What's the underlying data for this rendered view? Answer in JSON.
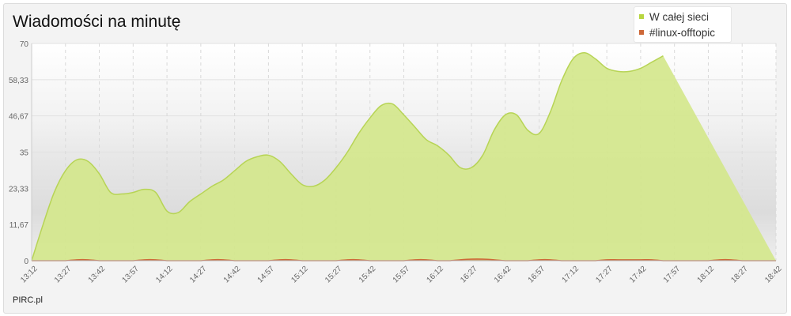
{
  "colors": {
    "series_fill": "#d4e78c",
    "series_line": "#b7d455",
    "series2": "#cd6838",
    "legend_marker1": "#b8d640",
    "legend_marker2": "#cd6838"
  },
  "chart_data": {
    "type": "area",
    "title": "Wiadomości na minutę",
    "credit": "PIRC.pl",
    "ylim": [
      0,
      70
    ],
    "y_ticks": [
      "0",
      "11,67",
      "23,33",
      "35",
      "46,67",
      "58,33",
      "70"
    ],
    "y_tick_values": [
      0,
      11.67,
      23.33,
      35,
      46.67,
      58.33,
      70
    ],
    "x_tick_labels": [
      "13:12",
      "13:27",
      "13:42",
      "13:57",
      "14:12",
      "14:27",
      "14:42",
      "14:57",
      "15:12",
      "15:27",
      "15:42",
      "15:57",
      "16:12",
      "16:27",
      "16:42",
      "16:57",
      "17:12",
      "17:27",
      "17:42",
      "17:57",
      "18:12",
      "18:27",
      "18:42"
    ],
    "legend_position": "top-right",
    "grid": true,
    "x": [
      "13:12",
      "13:17",
      "13:22",
      "13:27",
      "13:32",
      "13:37",
      "13:42",
      "13:47",
      "13:52",
      "13:57",
      "14:02",
      "14:07",
      "14:12",
      "14:17",
      "14:22",
      "14:27",
      "14:32",
      "14:37",
      "14:42",
      "14:47",
      "14:52",
      "14:57",
      "15:02",
      "15:07",
      "15:12",
      "15:17",
      "15:22",
      "15:27",
      "15:32",
      "15:37",
      "15:42",
      "15:47",
      "15:52",
      "15:57",
      "16:02",
      "16:07",
      "16:12",
      "16:17",
      "16:22",
      "16:27",
      "16:32",
      "16:37",
      "16:42",
      "16:47",
      "16:52",
      "16:57",
      "17:02",
      "17:07",
      "17:12",
      "17:17",
      "17:22",
      "17:27",
      "17:32",
      "17:37",
      "17:42",
      "17:47",
      "17:52",
      "17:57",
      "18:02",
      "18:07",
      "18:12",
      "18:17",
      "18:22",
      "18:27",
      "18:32",
      "18:37",
      "18:42"
    ],
    "series": [
      {
        "name": "W całej sieci",
        "values": [
          0,
          11.5,
          22,
          29,
          32.5,
          32,
          28,
          22,
          21.5,
          22,
          23,
          22,
          16,
          15.5,
          19,
          21.5,
          24,
          26,
          29,
          32,
          33.5,
          34,
          32,
          28,
          24.5,
          24,
          26,
          30,
          35,
          41,
          46,
          50,
          50.5,
          47,
          43,
          39,
          37,
          34,
          30,
          30,
          34,
          42,
          47,
          47,
          42,
          41,
          48,
          58,
          65,
          67,
          65,
          62,
          61,
          61,
          62,
          64,
          66
        ]
      },
      {
        "name": "#linux-offtopic",
        "values": [
          0,
          0,
          0,
          0,
          0.3,
          0.3,
          0,
          0,
          0,
          0,
          0.3,
          0.3,
          0,
          0,
          0,
          0,
          0.3,
          0.3,
          0,
          0,
          0,
          0,
          0.3,
          0.3,
          0,
          0,
          0,
          0,
          0.3,
          0.3,
          0,
          0,
          0,
          0,
          0.3,
          0.3,
          0,
          0,
          0.3,
          0.5,
          0.5,
          0.3,
          0,
          0,
          0,
          0.3,
          0.3,
          0,
          0,
          0,
          0,
          0.3,
          0.3,
          0.3,
          0.3,
          0.3,
          0,
          0,
          0,
          0,
          0,
          0.3,
          0.3,
          0,
          0,
          0,
          0
        ]
      }
    ]
  }
}
